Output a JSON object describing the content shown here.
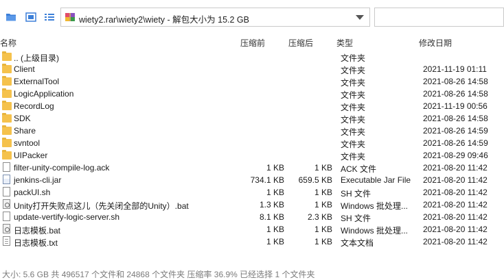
{
  "toolbar": {
    "path": "wiety2.rar\\wiety2\\wiety - 解包大小为 15.2 GB",
    "search_placeholder": ""
  },
  "columns": {
    "name": "名称",
    "before": "压缩前",
    "after": "压缩后",
    "type": "类型",
    "date": "修改日期"
  },
  "rows": [
    {
      "icon": "folder-icon",
      "name": ".. (上级目录)",
      "before": "",
      "after": "",
      "type": "文件夹",
      "date": ""
    },
    {
      "icon": "folder-icon",
      "name": "Client",
      "before": "",
      "after": "",
      "type": "文件夹",
      "date": "2021-11-19 01:11"
    },
    {
      "icon": "folder-icon",
      "name": "ExternalTool",
      "before": "",
      "after": "",
      "type": "文件夹",
      "date": "2021-08-26 14:58"
    },
    {
      "icon": "folder-icon",
      "name": "LogicApplication",
      "before": "",
      "after": "",
      "type": "文件夹",
      "date": "2021-08-26 14:58"
    },
    {
      "icon": "folder-icon",
      "name": "RecordLog",
      "before": "",
      "after": "",
      "type": "文件夹",
      "date": "2021-11-19 00:56"
    },
    {
      "icon": "folder-icon",
      "name": "SDK",
      "before": "",
      "after": "",
      "type": "文件夹",
      "date": "2021-08-26 14:58"
    },
    {
      "icon": "folder-icon",
      "name": "Share",
      "before": "",
      "after": "",
      "type": "文件夹",
      "date": "2021-08-26 14:59"
    },
    {
      "icon": "folder-icon",
      "name": "svntool",
      "before": "",
      "after": "",
      "type": "文件夹",
      "date": "2021-08-26 14:59"
    },
    {
      "icon": "folder-icon",
      "name": "UIPacker",
      "before": "",
      "after": "",
      "type": "文件夹",
      "date": "2021-08-29 09:46"
    },
    {
      "icon": "file-icon",
      "name": "filter-unity-compile-log.ack",
      "before": "1 KB",
      "after": "1 KB",
      "type": "ACK 文件",
      "date": "2021-08-20 11:42"
    },
    {
      "icon": "jar-file-icon",
      "name": "jenkins-cli.jar",
      "before": "734.1 KB",
      "after": "659.5 KB",
      "type": "Executable Jar File",
      "date": "2021-08-20 11:42"
    },
    {
      "icon": "file-icon",
      "name": "packUI.sh",
      "before": "1 KB",
      "after": "1 KB",
      "type": "SH 文件",
      "date": "2021-08-20 11:42"
    },
    {
      "icon": "batch-file-icon",
      "name": "Unity打开失败点这儿（先关闭全部的Unity）.bat",
      "before": "1.3 KB",
      "after": "1 KB",
      "type": "Windows 批处理...",
      "date": "2021-08-20 11:42"
    },
    {
      "icon": "file-icon",
      "name": "update-vertify-logic-server.sh",
      "before": "8.1 KB",
      "after": "2.3 KB",
      "type": "SH 文件",
      "date": "2021-08-20 11:42"
    },
    {
      "icon": "batch-file-icon",
      "name": "日志模板.bat",
      "before": "1 KB",
      "after": "1 KB",
      "type": "Windows 批处理...",
      "date": "2021-08-20 11:42"
    },
    {
      "icon": "text-file-icon",
      "name": "日志模板.txt",
      "before": "1 KB",
      "after": "1 KB",
      "type": "文本文档",
      "date": "2021-08-20 11:42"
    }
  ],
  "status": "大小: 5.6 GB 共 496517 个文件和 24868 个文件夹 压缩率 36.9% 已经选择 1 个文件夹",
  "colors": {
    "folder": "#f5c24c",
    "accent": "#3c7fd8"
  }
}
